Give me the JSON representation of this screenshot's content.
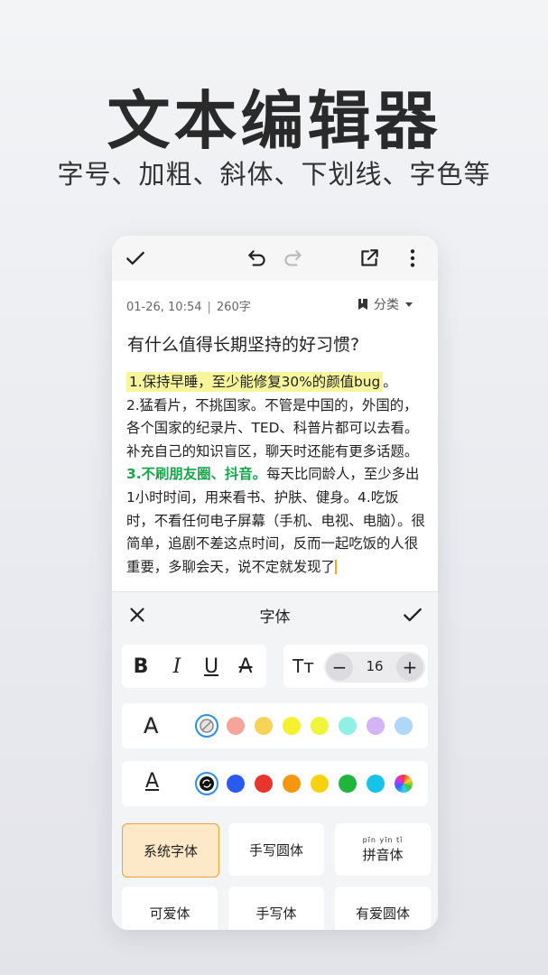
{
  "hero": {
    "title": "文本编辑器",
    "subtitle": "字号、加粗、斜体、下划线、字色等"
  },
  "note": {
    "timestamp": "01-26, 10:54",
    "word_count": "260字",
    "category_label": "分类",
    "title": "有什么值得长期坚持的好习惯?",
    "p1": "1.保持早睡，至少能修复30%的颜值bug",
    "p1_end": "。",
    "p2": "2.猛看片，不挑国家。不管是中国的，外国的，各个国家的纪录片、TED、科普片都可以去看。补充自己的知识盲区，聊天时还能有更多话题。",
    "p3_bold": "3.不刷朋友圈、抖音。",
    "p3_rest": "每天比同龄人，至少多出1小时时间，用来看书、护肤、健身。4.吃饭时，不看任何电子屏幕（手机、电视、电脑）。很简单，追剧不差这点时间，反而一起吃饭的人很重要，多聊会天，说不定就发现了"
  },
  "panel": {
    "title": "字体",
    "bold_label": "B",
    "italic_label": "I",
    "underline_label": "U",
    "strike_label": "A",
    "size_icon": "Tт",
    "size_minus": "−",
    "size_value": "16",
    "size_plus": "+",
    "highlight_icon": "A",
    "textcolor_icon": "A"
  },
  "highlight_colors": [
    "#f5a59a",
    "#f7d35a",
    "#f6f02e",
    "#eef53a",
    "#8ef1e4",
    "#d4b4f5",
    "#b0d6f8"
  ],
  "text_colors": [
    "#2a5bef",
    "#e8342c",
    "#f5960f",
    "#f7d20e",
    "#20b53c",
    "#17c3e8"
  ],
  "fonts": [
    {
      "label": "系统字体",
      "active": true
    },
    {
      "label": "手写圆体",
      "active": false
    },
    {
      "label": "拼音体",
      "pinyin": "pīn yīn tǐ",
      "active": false
    },
    {
      "label": "可爱体",
      "active": false
    },
    {
      "label": "手写体",
      "active": false
    },
    {
      "label": "有爱圆体",
      "active": false
    }
  ],
  "icons": {
    "done": "check-icon",
    "undo": "undo-icon",
    "redo": "redo-icon",
    "share": "share-icon",
    "more": "more-vertical-icon",
    "close": "close-icon",
    "confirm": "check-icon"
  }
}
